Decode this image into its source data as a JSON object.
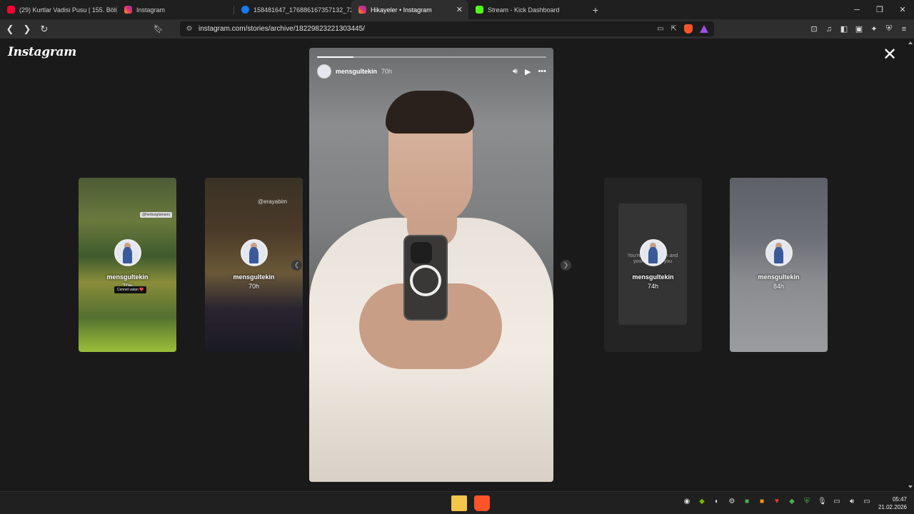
{
  "browser": {
    "tabs": [
      {
        "title": "(29) Kurtlar Vadisi Pusu | 155. Bölüm |",
        "icon": "youtube-icon",
        "color": "#ff0033"
      },
      {
        "title": "Instagram",
        "icon": "instagram-icon",
        "color": "#e1306c"
      },
      {
        "title": "158481647_176886167357132_7207(",
        "icon": "facebook-icon",
        "color": "#1877f2"
      },
      {
        "title": "Hikayeler • Instagram",
        "icon": "instagram-icon",
        "color": "#e1306c",
        "active": true
      },
      {
        "title": "Stream - Kick Dashboard",
        "icon": "kick-icon",
        "color": "#53fc18"
      }
    ],
    "new_tab": "+",
    "url": "instagram.com/stories/archive/18229823221303445/"
  },
  "page": {
    "logo": "Instagram",
    "close": "✕"
  },
  "story": {
    "username": "mensgultekin",
    "age": "70h",
    "progress": 0.16
  },
  "thumbnails": [
    {
      "username": "mensgultekin",
      "age": "70h",
      "watermark": "@herburgtamamı",
      "sticker": "Cennet vatan ❤️"
    },
    {
      "username": "mensgultekin",
      "age": "70h",
      "watermark": "@erayabim"
    },
    {
      "username": "mensgultekin",
      "age": "74h",
      "caption": "POV:\nYou're on vacation and\nyour cat calls you"
    },
    {
      "username": "mensgultekin",
      "age": "84h"
    }
  ],
  "taskbar": {
    "time": "05:47",
    "date": "21.02.2026"
  }
}
